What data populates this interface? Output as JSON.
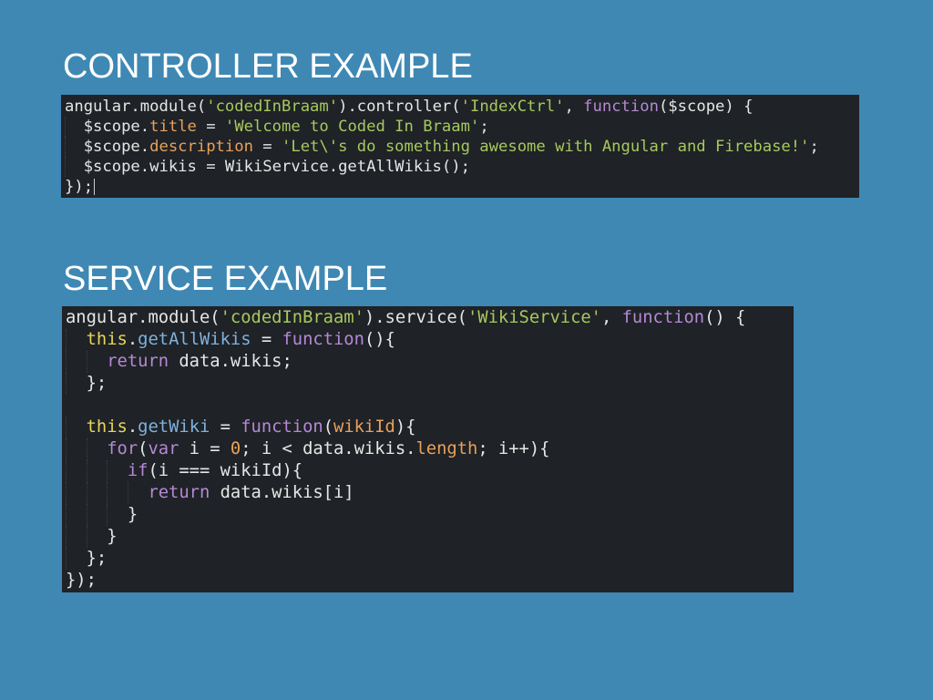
{
  "slide": {
    "background_color": "#3f88b4",
    "controller_title": "CONTROLLER EXAMPLE",
    "service_title": "SERVICE EXAMPLE"
  },
  "colors": {
    "code_background": "#1f2226",
    "string": "#a6c95e",
    "keyword": "#b589d6",
    "property": "#e8a15a",
    "this_keyword": "#e6d55c"
  },
  "controller_code": [
    {
      "indent": 0,
      "tokens": [
        {
          "t": "plain",
          "v": "angular.module("
        },
        {
          "t": "str",
          "v": "'codedInBraam'"
        },
        {
          "t": "plain",
          "v": ").controller("
        },
        {
          "t": "str",
          "v": "'IndexCtrl'"
        },
        {
          "t": "plain",
          "v": ", "
        },
        {
          "t": "kw",
          "v": "function"
        },
        {
          "t": "plain",
          "v": "($scope) {"
        }
      ]
    },
    {
      "indent": 1,
      "tokens": [
        {
          "t": "plain",
          "v": "$scope."
        },
        {
          "t": "prop",
          "v": "title"
        },
        {
          "t": "plain",
          "v": " = "
        },
        {
          "t": "str",
          "v": "'Welcome to Coded In Braam'"
        },
        {
          "t": "plain",
          "v": ";"
        }
      ]
    },
    {
      "indent": 1,
      "tokens": [
        {
          "t": "plain",
          "v": "$scope."
        },
        {
          "t": "prop",
          "v": "description"
        },
        {
          "t": "plain",
          "v": " = "
        },
        {
          "t": "str",
          "v": "'Let\\'s do something awesome with Angular and Firebase!'"
        },
        {
          "t": "plain",
          "v": ";"
        }
      ]
    },
    {
      "indent": 1,
      "tokens": [
        {
          "t": "plain",
          "v": "$scope.wikis = WikiService.getAllWikis();"
        }
      ]
    },
    {
      "indent": 0,
      "tokens": [
        {
          "t": "plain",
          "v": "});"
        }
      ],
      "cursor": true
    }
  ],
  "service_code": [
    {
      "indent": 0,
      "tokens": [
        {
          "t": "plain",
          "v": "angular.module("
        },
        {
          "t": "str",
          "v": "'codedInBraam'"
        },
        {
          "t": "plain",
          "v": ").service("
        },
        {
          "t": "str",
          "v": "'WikiService'"
        },
        {
          "t": "plain",
          "v": ", "
        },
        {
          "t": "kw",
          "v": "function"
        },
        {
          "t": "plain",
          "v": "() {"
        }
      ]
    },
    {
      "indent": 1,
      "tokens": [
        {
          "t": "this",
          "v": "this"
        },
        {
          "t": "plain",
          "v": "."
        },
        {
          "t": "fn",
          "v": "getAllWikis"
        },
        {
          "t": "plain",
          "v": " = "
        },
        {
          "t": "kw",
          "v": "function"
        },
        {
          "t": "plain",
          "v": "(){"
        }
      ]
    },
    {
      "indent": 2,
      "tokens": [
        {
          "t": "kw",
          "v": "return"
        },
        {
          "t": "plain",
          "v": " data.wikis;"
        }
      ]
    },
    {
      "indent": 1,
      "tokens": [
        {
          "t": "plain",
          "v": "};"
        }
      ]
    },
    {
      "indent": 0,
      "tokens": []
    },
    {
      "indent": 1,
      "tokens": [
        {
          "t": "this",
          "v": "this"
        },
        {
          "t": "plain",
          "v": "."
        },
        {
          "t": "fn",
          "v": "getWiki"
        },
        {
          "t": "plain",
          "v": " = "
        },
        {
          "t": "kw",
          "v": "function"
        },
        {
          "t": "plain",
          "v": "("
        },
        {
          "t": "prop",
          "v": "wikiId"
        },
        {
          "t": "plain",
          "v": "){"
        }
      ]
    },
    {
      "indent": 2,
      "tokens": [
        {
          "t": "kw",
          "v": "for"
        },
        {
          "t": "plain",
          "v": "("
        },
        {
          "t": "kw",
          "v": "var"
        },
        {
          "t": "plain",
          "v": " i = "
        },
        {
          "t": "num",
          "v": "0"
        },
        {
          "t": "plain",
          "v": "; i < data.wikis."
        },
        {
          "t": "prop",
          "v": "length"
        },
        {
          "t": "plain",
          "v": "; i++){"
        }
      ]
    },
    {
      "indent": 3,
      "tokens": [
        {
          "t": "kw",
          "v": "if"
        },
        {
          "t": "plain",
          "v": "(i === wikiId){"
        }
      ]
    },
    {
      "indent": 4,
      "tokens": [
        {
          "t": "kw",
          "v": "return"
        },
        {
          "t": "plain",
          "v": " data.wikis[i]"
        }
      ]
    },
    {
      "indent": 3,
      "tokens": [
        {
          "t": "plain",
          "v": "}"
        }
      ]
    },
    {
      "indent": 2,
      "tokens": [
        {
          "t": "plain",
          "v": "}"
        }
      ]
    },
    {
      "indent": 1,
      "tokens": [
        {
          "t": "plain",
          "v": "};"
        }
      ]
    },
    {
      "indent": 0,
      "tokens": [
        {
          "t": "plain",
          "v": "});"
        }
      ]
    }
  ]
}
